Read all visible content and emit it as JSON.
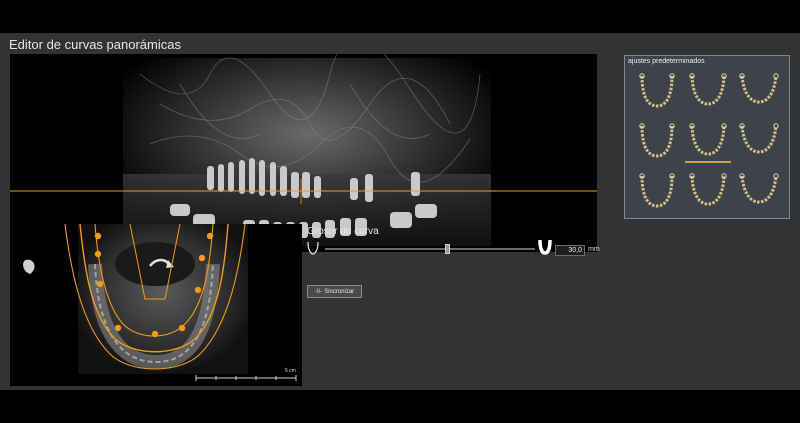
{
  "window": {
    "title": "Editor de curvas panorámicas"
  },
  "presets": {
    "title": "ajustes predeterminados",
    "count": 9,
    "selected_index": 4
  },
  "curve": {
    "label": "Grosor de curva",
    "thickness_value": "30,0",
    "unit": "mm",
    "slider_level": 0.6
  },
  "sync_button": {
    "icon_text": "-\\/-",
    "label": "Sincronizar"
  },
  "axial_view": {
    "scale_label": "5 cm"
  },
  "colors": {
    "curve": "#f29b1a",
    "accent": "#d4a040",
    "background": "#333333"
  }
}
